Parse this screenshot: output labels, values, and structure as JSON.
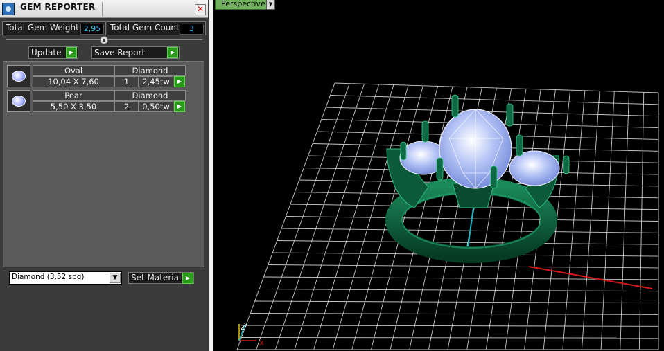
{
  "window": {
    "title": "GEM REPORTER",
    "close_glyph": "✕",
    "icon": "gem-reporter-icon"
  },
  "stats": {
    "weight_label": "Total Gem Weight",
    "weight_value": "2,95",
    "count_label": "Total Gem Count",
    "count_value": "3"
  },
  "slider_glyph": "▲",
  "actions": {
    "update_label": "Update",
    "save_label": "Save Report",
    "go_glyph": "▶"
  },
  "gems": [
    {
      "shape": "Oval",
      "material": "Diamond",
      "size": "10,04 X 7,60",
      "count": "1",
      "weight": "2,45tw"
    },
    {
      "shape": "Pear",
      "material": "Diamond",
      "size": "5,50 X 3,50",
      "count": "2",
      "weight": "0,50tw"
    }
  ],
  "material": {
    "selected": "Diamond      (3,52 spg)",
    "arrow": "▼",
    "set_label": "Set Material"
  },
  "viewport": {
    "label": "Perspective",
    "menu_glyph": "▼",
    "axis_x": "X",
    "axis_y": "Y",
    "axis_z": "Z",
    "colors": {
      "grid": "#c8c8c8",
      "ring_metal": "#0d5a3a",
      "gem": "#9fb4f0",
      "x_axis": "#d41818",
      "z_axis": "#18b8c8"
    }
  }
}
